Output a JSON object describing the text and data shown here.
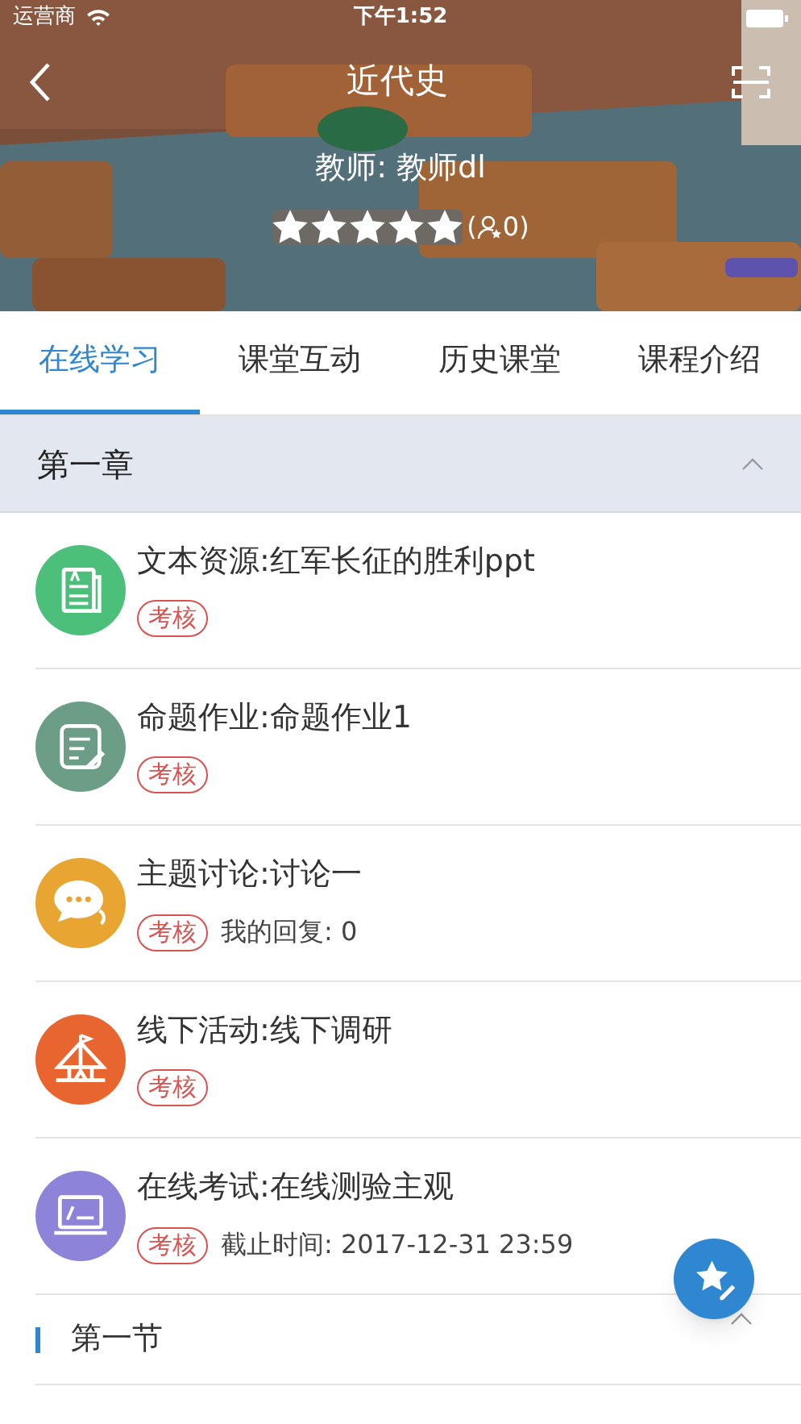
{
  "status_bar": {
    "carrier": "运营商",
    "time": "下午1:52"
  },
  "header": {
    "title": "近代史",
    "teacher": "教师: 教师dl",
    "stars": 5,
    "rating_open": "(",
    "rating_count": "0",
    "rating_close": ")"
  },
  "tabs": [
    {
      "label": "在线学习",
      "selected": true
    },
    {
      "label": "课堂互动",
      "selected": false
    },
    {
      "label": "历史课堂",
      "selected": false
    },
    {
      "label": "课程介绍",
      "selected": false
    }
  ],
  "chapter": {
    "title": "第一章",
    "expanded": true,
    "items": [
      {
        "kind": "document",
        "color": "#4cbf7b",
        "title": "文本资源:红军长征的胜利ppt",
        "badge": "考核"
      },
      {
        "kind": "assignment",
        "color": "#6b9d87",
        "title": "命题作业:命题作业1",
        "badge": "考核"
      },
      {
        "kind": "discussion",
        "color": "#e9a532",
        "title": "主题讨论:讨论一",
        "badge": "考核",
        "note": "我的回复: 0"
      },
      {
        "kind": "activity",
        "color": "#e8652f",
        "title": "线下活动:线下调研",
        "badge": "考核"
      },
      {
        "kind": "exam",
        "color": "#8d84d9",
        "title": "在线考试:在线测验主观",
        "badge": "考核",
        "note": "截止时间: 2017-12-31 23:59"
      }
    ]
  },
  "section": {
    "title": "第一节",
    "expanded": true
  }
}
